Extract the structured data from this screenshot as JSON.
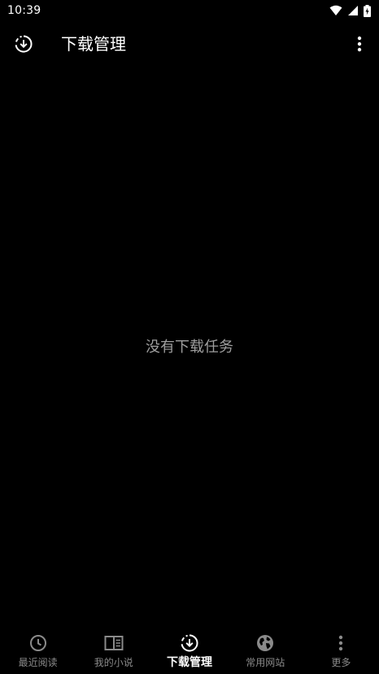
{
  "status_bar": {
    "time": "10:39"
  },
  "app_bar": {
    "title": "下载管理",
    "leading_icon": "download-circle-icon",
    "overflow_icon": "more-vert-icon"
  },
  "main": {
    "empty_message": "没有下载任务"
  },
  "bottom_nav": {
    "items": [
      {
        "label": "最近阅读",
        "icon": "clock-icon",
        "active": false
      },
      {
        "label": "我的小说",
        "icon": "book-icon",
        "active": false
      },
      {
        "label": "下载管理",
        "icon": "download-circle-icon",
        "active": true
      },
      {
        "label": "常用网站",
        "icon": "globe-icon",
        "active": false
      },
      {
        "label": "更多",
        "icon": "more-vert-icon",
        "active": false
      }
    ]
  },
  "colors": {
    "background": "#000000",
    "text_primary": "#ffffff",
    "text_secondary": "#8a8a8a",
    "empty_text": "#9e9e9e"
  }
}
